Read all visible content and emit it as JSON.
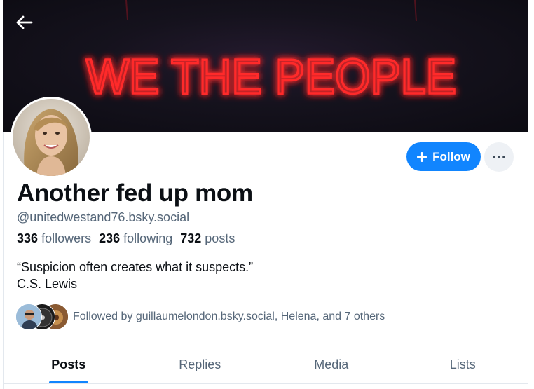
{
  "banner": {
    "neon_text": "WE THE PEOPLE",
    "neon_color": "#ff2a2a",
    "line_color": "#3a6bff"
  },
  "nav": {
    "back_icon": "arrow-left-icon"
  },
  "profile": {
    "display_name": "Another fed up mom",
    "handle": "@unitedwestand76.bsky.social",
    "stats": {
      "followers_count": "336",
      "followers_label": "followers",
      "following_count": "236",
      "following_label": "following",
      "posts_count": "732",
      "posts_label": "posts"
    },
    "bio_lines": [
      "“Suspicion often creates what it suspects.”",
      "C.S. Lewis"
    ],
    "followed_by": "Followed by guillaumelondon.bsky.social, Helena, and 7 others"
  },
  "actions": {
    "follow_label": "Follow",
    "follow_icon": "plus-icon",
    "more_icon": "ellipsis-icon",
    "accent": "#1185fe"
  },
  "tabs": [
    {
      "label": "Posts",
      "active": true
    },
    {
      "label": "Replies",
      "active": false
    },
    {
      "label": "Media",
      "active": false
    },
    {
      "label": "Lists",
      "active": false
    }
  ]
}
